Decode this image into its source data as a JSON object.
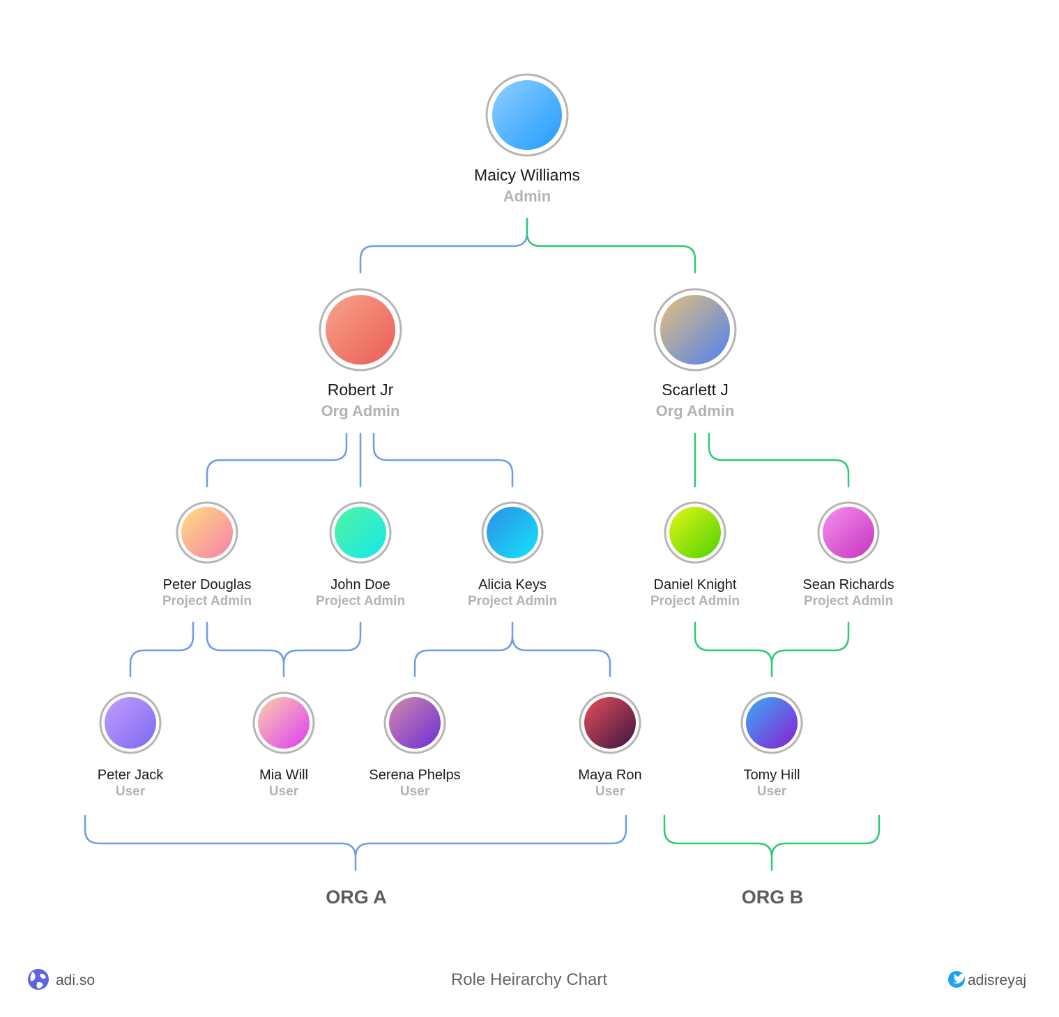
{
  "colors": {
    "org_a_line": "#6f9be8",
    "org_b_line": "#2ec971",
    "ring": "#b5b5b5"
  },
  "nodes": {
    "maicy": {
      "name": "Maicy Williams",
      "role": "Admin",
      "gradient": [
        "#8fd0ff",
        "#1f9bff"
      ]
    },
    "robert": {
      "name": "Robert Jr",
      "role": "Org Admin",
      "gradient": [
        "#f5a58a",
        "#ec5b56"
      ]
    },
    "scarlett": {
      "name": "Scarlett J",
      "role": "Org Admin",
      "gradient": [
        "#e5c07b",
        "#4f80ee"
      ]
    },
    "peterd": {
      "name": "Peter Douglas",
      "role": "Project Admin",
      "gradient": [
        "#ffdd80",
        "#f57faa"
      ]
    },
    "john": {
      "name": "John Doe",
      "role": "Project Admin",
      "gradient": [
        "#52f2a0",
        "#15e8ea"
      ]
    },
    "alicia": {
      "name": "Alicia Keys",
      "role": "Project Admin",
      "gradient": [
        "#2e8ee8",
        "#14e3f8"
      ]
    },
    "daniel": {
      "name": "Daniel Knight",
      "role": "Project Admin",
      "gradient": [
        "#e5f51a",
        "#4bd200"
      ]
    },
    "sean": {
      "name": "Sean Richards",
      "role": "Project Admin",
      "gradient": [
        "#f590ee",
        "#c633bf"
      ]
    },
    "peterj": {
      "name": "Peter Jack",
      "role": "User",
      "gradient": [
        "#c39dfe",
        "#7b69f0"
      ]
    },
    "mia": {
      "name": "Mia Will",
      "role": "User",
      "gradient": [
        "#fdd0a6",
        "#dd3cf5"
      ]
    },
    "serena": {
      "name": "Serena Phelps",
      "role": "User",
      "gradient": [
        "#d38aa8",
        "#6a2dd6"
      ]
    },
    "maya": {
      "name": "Maya Ron",
      "role": "User",
      "gradient": [
        "#e84d5c",
        "#3a1640"
      ]
    },
    "tomy": {
      "name": "Tomy Hill",
      "role": "User",
      "gradient": [
        "#39aef5",
        "#8a1bd2"
      ]
    }
  },
  "groups": {
    "org_a": "ORG A",
    "org_b": "ORG B"
  },
  "footer": {
    "website": "adi.so",
    "title": "Role Heirarchy Chart",
    "handle": "adisreyaj",
    "website_icon": "globe-icon",
    "handle_icon": "twitter-icon"
  }
}
